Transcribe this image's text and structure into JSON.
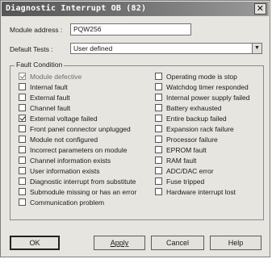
{
  "title": "Diagnostic Interrupt OB (82)",
  "module_address": {
    "label": "Module address :",
    "value": "PQW256"
  },
  "default_tests": {
    "label": "Default Tests :",
    "value": "User defined"
  },
  "fault_condition": {
    "title": "Fault Condition",
    "left": [
      {
        "label": "Module defective",
        "checked": true,
        "enabled": false
      },
      {
        "label": "Internal fault",
        "checked": false,
        "enabled": true
      },
      {
        "label": "External fault",
        "checked": false,
        "enabled": true
      },
      {
        "label": "Channel fault",
        "checked": false,
        "enabled": true
      },
      {
        "label": "External voltage failed",
        "checked": true,
        "enabled": true
      },
      {
        "label": "Front panel connector unplugged",
        "checked": false,
        "enabled": true
      },
      {
        "label": "Module not configured",
        "checked": false,
        "enabled": true
      },
      {
        "label": "Incorrect parameters on module",
        "checked": false,
        "enabled": true
      },
      {
        "label": "Channel information exists",
        "checked": false,
        "enabled": true
      },
      {
        "label": "User information exists",
        "checked": false,
        "enabled": true
      },
      {
        "label": "Diagnostic interrupt from substitute",
        "checked": false,
        "enabled": true
      },
      {
        "label": "Submodule missing or has an error",
        "checked": false,
        "enabled": true
      },
      {
        "label": "Communication problem",
        "checked": false,
        "enabled": true
      }
    ],
    "right": [
      {
        "label": "Operating mode is stop",
        "checked": false,
        "enabled": true
      },
      {
        "label": "Watchdog timer responded",
        "checked": false,
        "enabled": true
      },
      {
        "label": "Internal power supply failed",
        "checked": false,
        "enabled": true
      },
      {
        "label": "Battery exhausted",
        "checked": false,
        "enabled": true
      },
      {
        "label": "Entire backup failed",
        "checked": false,
        "enabled": true
      },
      {
        "label": "Expansion rack failure",
        "checked": false,
        "enabled": true
      },
      {
        "label": "Processor failure",
        "checked": false,
        "enabled": true
      },
      {
        "label": "EPROM fault",
        "checked": false,
        "enabled": true
      },
      {
        "label": "RAM fault",
        "checked": false,
        "enabled": true
      },
      {
        "label": "ADC/DAC error",
        "checked": false,
        "enabled": true
      },
      {
        "label": "Fuse tripped",
        "checked": false,
        "enabled": true
      },
      {
        "label": "Hardware interrupt lost",
        "checked": false,
        "enabled": true
      }
    ]
  },
  "buttons": {
    "ok": "OK",
    "apply": "Apply",
    "cancel": "Cancel",
    "help": "Help"
  }
}
